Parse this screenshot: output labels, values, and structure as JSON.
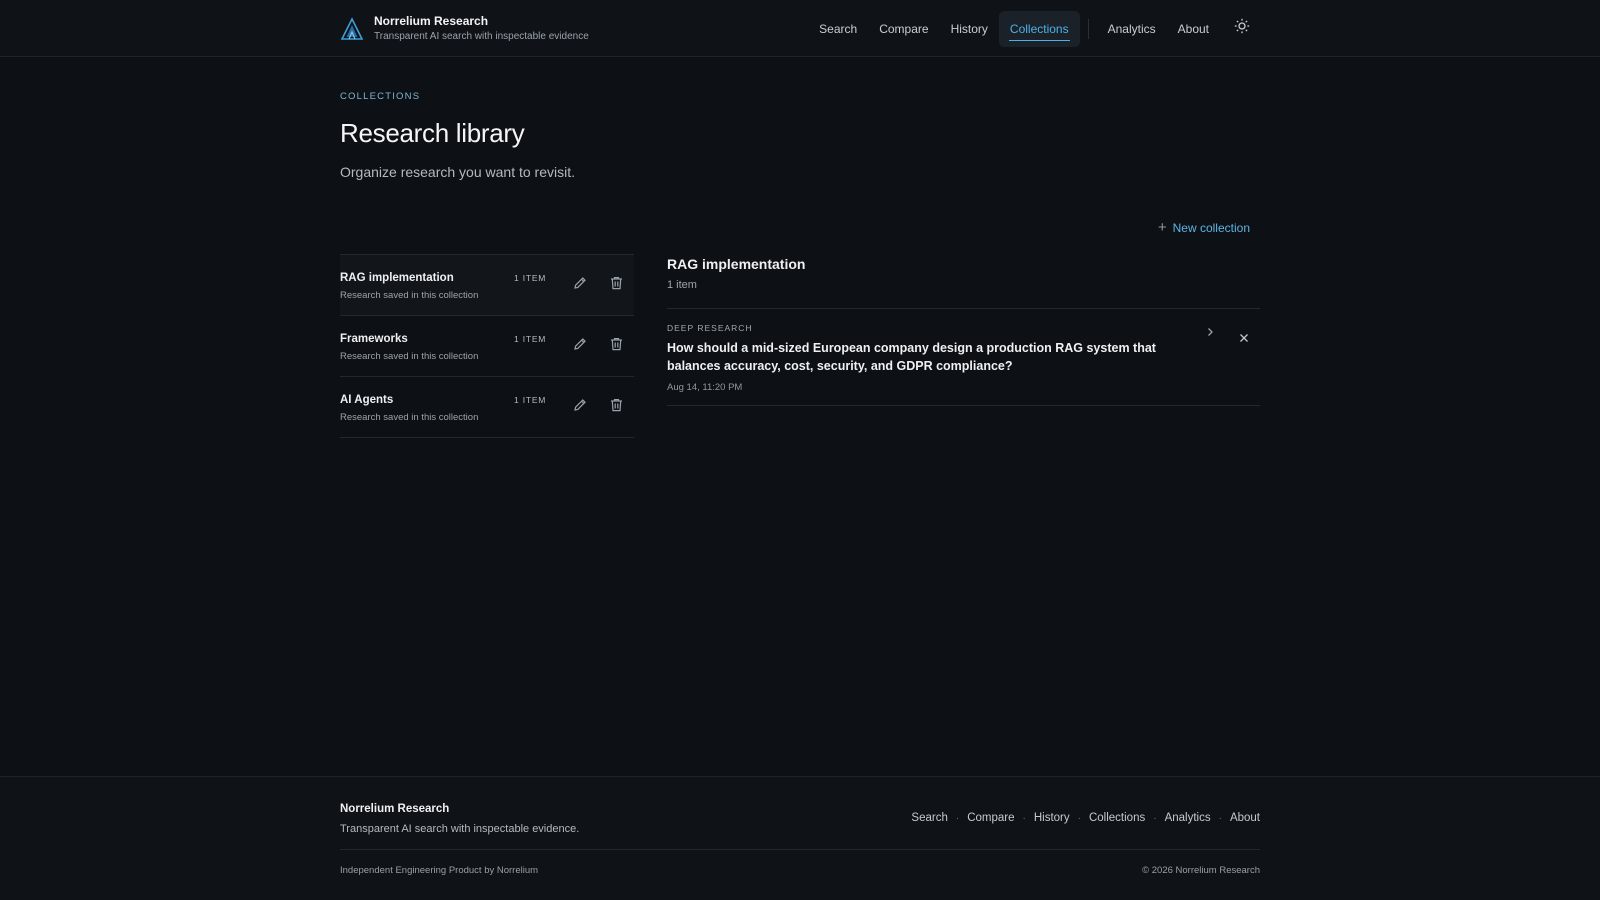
{
  "header": {
    "brand_name": "Norrelium Research",
    "brand_tagline": "Transparent AI search with inspectable evidence",
    "nav": [
      "Search",
      "Compare",
      "History",
      "Collections",
      "Analytics",
      "About"
    ],
    "active_nav": "Collections",
    "theme_icon": "sun-icon"
  },
  "hero": {
    "eyebrow": "COLLECTIONS",
    "title": "Research library",
    "subtitle": "Organize research you want to revisit."
  },
  "toolbar": {
    "new_collection_label": "New collection"
  },
  "collections": [
    {
      "name": "RAG implementation",
      "description": "Research saved in this collection",
      "count": "1 ITEM"
    },
    {
      "name": "Frameworks",
      "description": "Research saved in this collection",
      "count": "1 ITEM"
    },
    {
      "name": "AI Agents",
      "description": "Research saved in this collection",
      "count": "1 ITEM"
    }
  ],
  "detail": {
    "title": "RAG implementation",
    "count": "1 item",
    "items": [
      {
        "kind": "DEEP RESEARCH",
        "title": "How should a mid-sized European company design a production RAG system that balances accuracy, cost, security, and GDPR compliance?",
        "date": "Aug 14, 11:20 PM"
      }
    ]
  },
  "footer": {
    "brand_name": "Norrelium Research",
    "tagline": "Transparent AI search with inspectable evidence.",
    "links": [
      "Search",
      "Compare",
      "History",
      "Collections",
      "Analytics",
      "About"
    ],
    "credit": "Independent Engineering Product by Norrelium",
    "copyright": "© 2026 Norrelium Research"
  },
  "colors": {
    "background": "#0d1014",
    "accent": "#4fb0e6",
    "text": "#e6e8eb"
  }
}
